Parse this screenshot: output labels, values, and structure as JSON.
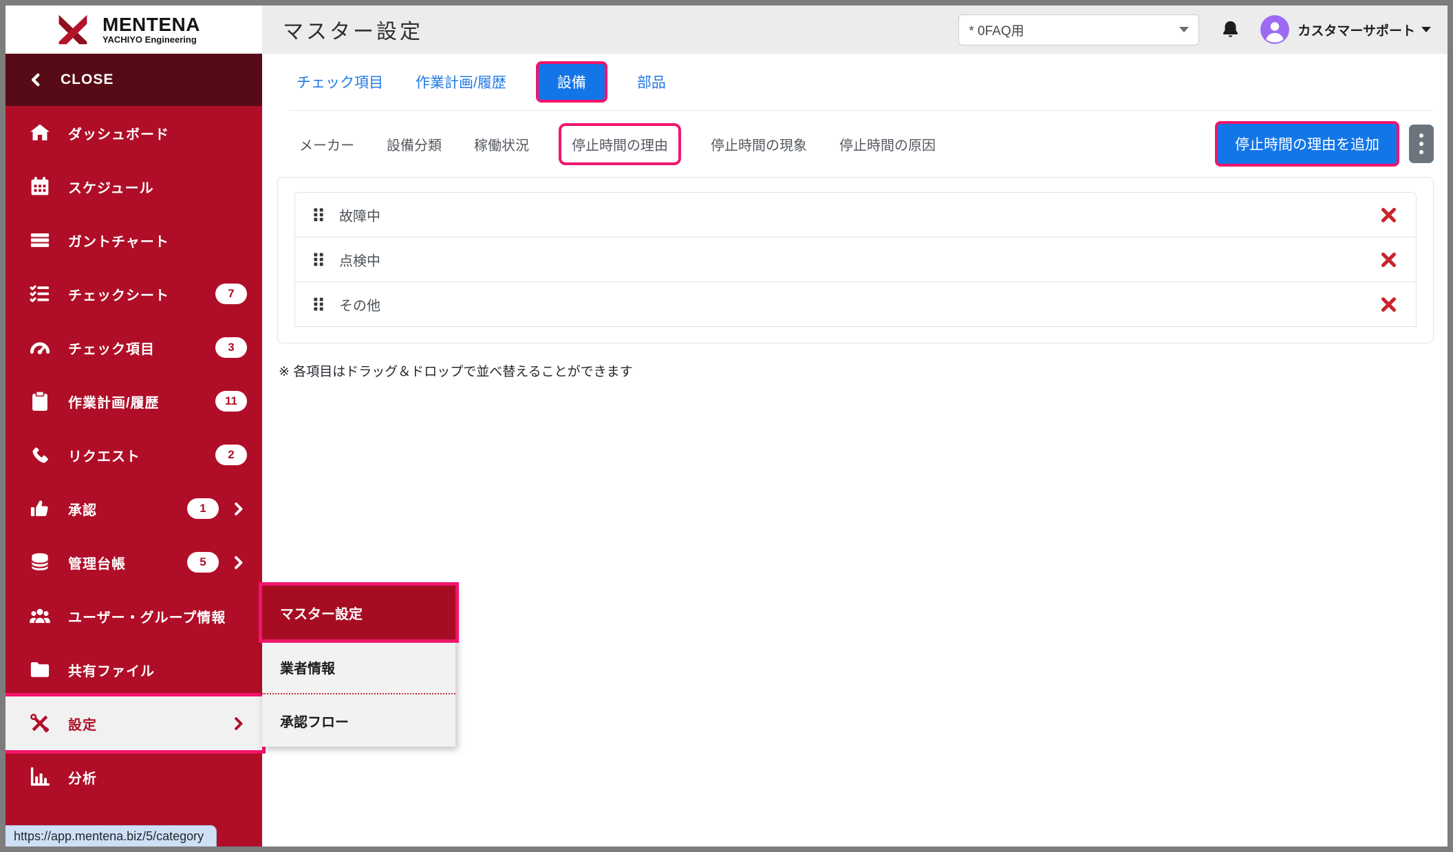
{
  "brand": {
    "name": "MENTENA",
    "subtitle": "YACHIYO Engineering"
  },
  "header": {
    "title": "マスター設定",
    "workspace_select": {
      "value": "* 0FAQ用"
    },
    "user_name": "カスタマーサポート"
  },
  "sidebar": {
    "close_label": "CLOSE",
    "items": [
      {
        "key": "dashboard",
        "icon": "home",
        "label": "ダッシュボード"
      },
      {
        "key": "schedule",
        "icon": "calendar",
        "label": "スケジュール"
      },
      {
        "key": "gantt-chart",
        "icon": "gantt",
        "label": "ガントチャート"
      },
      {
        "key": "check-sheet",
        "icon": "checklist",
        "label": "チェックシート",
        "badge": "7"
      },
      {
        "key": "check-item",
        "icon": "gauge",
        "label": "チェック項目",
        "badge": "3"
      },
      {
        "key": "work-plan-history",
        "icon": "clipboard",
        "label": "作業計画/履歴",
        "badge": "11"
      },
      {
        "key": "request",
        "icon": "phone",
        "label": "リクエスト",
        "badge": "2"
      },
      {
        "key": "approval",
        "icon": "thumbs-up",
        "label": "承認",
        "badge": "1",
        "expand": true
      },
      {
        "key": "ledger",
        "icon": "database",
        "label": "管理台帳",
        "badge": "5",
        "expand": true
      },
      {
        "key": "user-group-info",
        "icon": "users",
        "label": "ユーザー・グループ情報"
      },
      {
        "key": "shared-files",
        "icon": "folder",
        "label": "共有ファイル"
      },
      {
        "key": "settings",
        "icon": "tools",
        "label": "設定",
        "expand": true,
        "active": true,
        "annotated": true
      },
      {
        "key": "analysis",
        "icon": "chart",
        "label": "分析"
      }
    ]
  },
  "submenu": {
    "items": [
      {
        "key": "master-settings",
        "label": "マスター設定",
        "active": true,
        "annotated": true
      },
      {
        "key": "vendor-info",
        "label": "業者情報"
      },
      {
        "key": "approval-flow",
        "label": "承認フロー"
      }
    ]
  },
  "main": {
    "tabs": [
      {
        "key": "check-item",
        "label": "チェック項目"
      },
      {
        "key": "work-plan-history",
        "label": "作業計画/履歴"
      },
      {
        "key": "equipment",
        "label": "設備",
        "active": true,
        "annotated": true
      },
      {
        "key": "parts",
        "label": "部品"
      }
    ],
    "subtabs": [
      {
        "key": "maker",
        "label": "メーカー"
      },
      {
        "key": "equipment-category",
        "label": "設備分類"
      },
      {
        "key": "operation-status",
        "label": "稼働状況"
      },
      {
        "key": "downtime-reason",
        "label": "停止時間の理由",
        "annotated": true
      },
      {
        "key": "downtime-phenomenon",
        "label": "停止時間の現象"
      },
      {
        "key": "downtime-cause",
        "label": "停止時間の原因"
      }
    ],
    "add_button_label": "停止時間の理由を追加",
    "list": {
      "items": [
        {
          "key": "failure",
          "label": "故障中"
        },
        {
          "key": "inspection",
          "label": "点検中"
        },
        {
          "key": "other",
          "label": "その他"
        }
      ]
    },
    "note": "※ 各項目はドラッグ＆ドロップで並べ替えることができます"
  },
  "statusbar": {
    "url": "https://app.mentena.biz/5/category"
  },
  "colors": {
    "sidebar_red": "#b00e28",
    "sidebar_dark": "#570b16",
    "submenu_active_red": "#a60d23",
    "primary_blue": "#1376e8",
    "link_blue": "#2079e8",
    "annotation_pink": "#f1156c",
    "delete_red": "#c9242e",
    "avatar_purple": "#9d6bf3",
    "statusbar_bg": "#cfe0f6"
  }
}
